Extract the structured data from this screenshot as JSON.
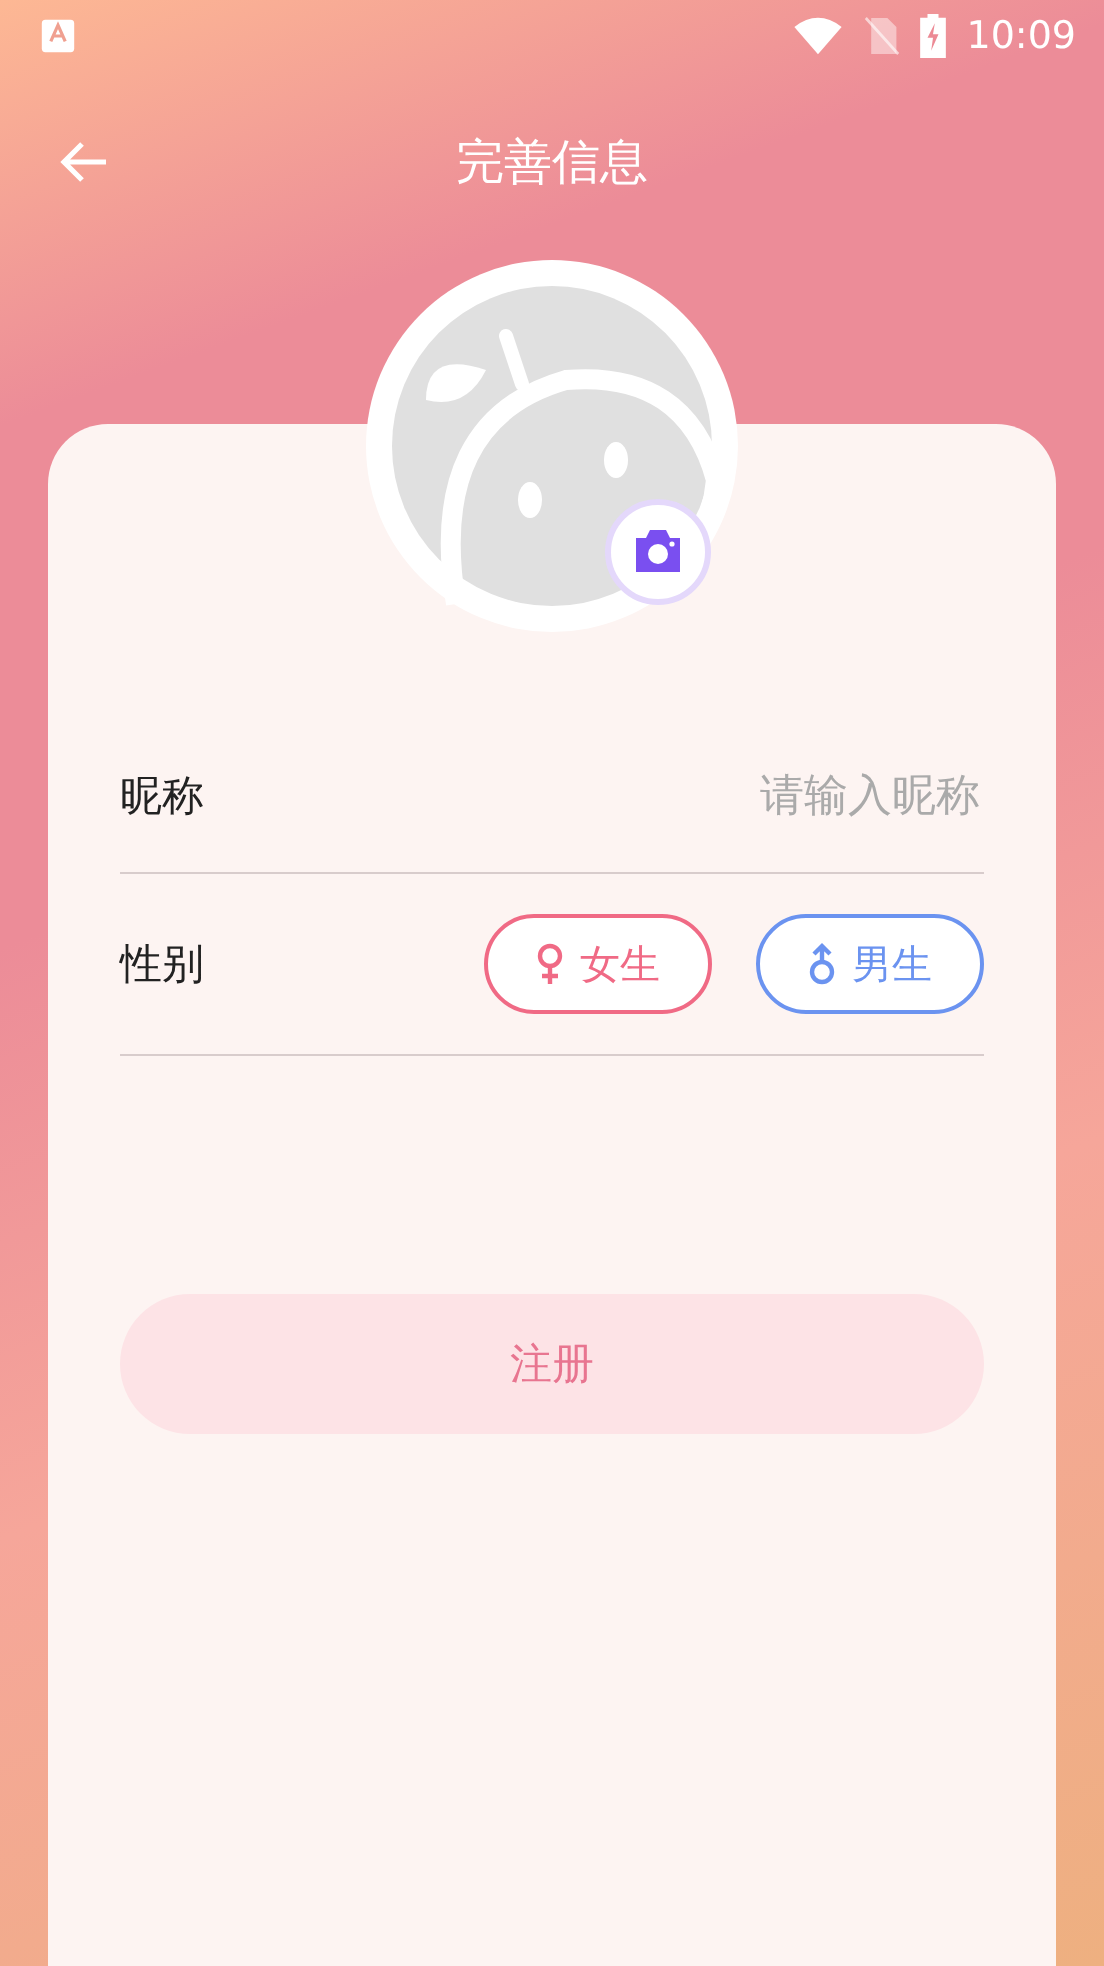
{
  "status_bar": {
    "time": "10:09"
  },
  "header": {
    "title": "完善信息"
  },
  "form": {
    "nickname": {
      "label": "昵称",
      "placeholder": "请输入昵称"
    },
    "gender": {
      "label": "性别",
      "options": [
        {
          "kind": "female",
          "label": "女生",
          "color": "#f06a85",
          "selected": false
        },
        {
          "kind": "male",
          "label": "男生",
          "color": "#6b93f0",
          "selected": false
        }
      ]
    }
  },
  "register_button": {
    "label": "注册",
    "disabled": true
  }
}
